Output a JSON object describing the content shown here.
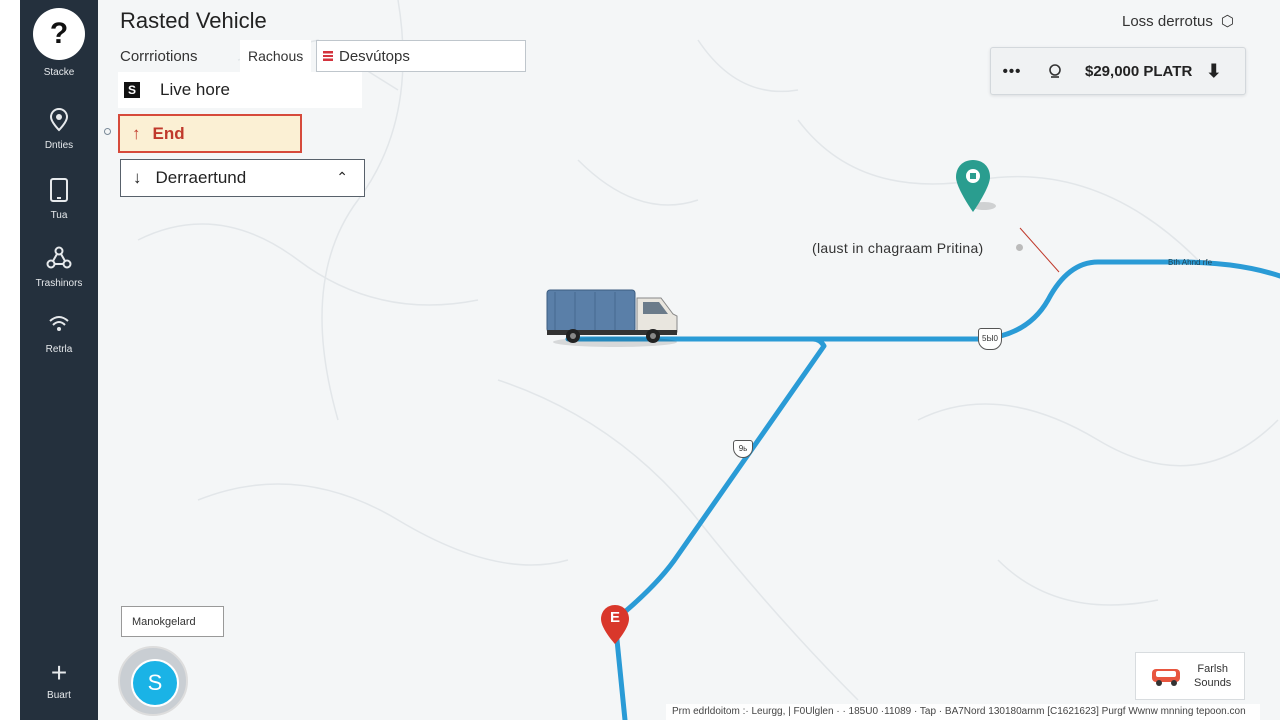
{
  "sidebar": {
    "help": {
      "glyph": "?",
      "label": "Stacke"
    },
    "items": [
      {
        "label": "Dnties",
        "icon": "map-pin-icon"
      },
      {
        "label": "Tua",
        "icon": "tablet-icon"
      },
      {
        "label": "Trashinors",
        "icon": "network-icon"
      },
      {
        "label": "Retrla",
        "icon": "wifi-icon"
      }
    ],
    "bottom": {
      "glyph": "+",
      "label": "Buart"
    }
  },
  "header": {
    "title": "Rasted Vehicle",
    "tab_1": "Corrriotions",
    "tab_2": "Rachous",
    "search_value": "Desvútops"
  },
  "panel": {
    "live_icon": "S",
    "live_label": "Live hore",
    "end_label": "End",
    "dropdown_label": "Derraertund"
  },
  "top_right": {
    "label": "Loss derrotus"
  },
  "stats": {
    "price": "$29,000 PLATR"
  },
  "map": {
    "note": "(laust in chagraam Pritina)",
    "route_badge_1": "5Ы0",
    "route_badge_2": "9ь",
    "road_label": "Bth Ahnd rfe",
    "end_marker": "E",
    "route_color": "#2a9bd6"
  },
  "manage_button": "Manokgelard",
  "s_button": "S",
  "legend": {
    "line_1": "Farlsh",
    "line_2": "Sounds"
  },
  "footer": "Prm edrldoitom :· Leurgg, | F0Ulglen · · 185U0 ·11089 · Tap · BA7Nord  130180arnm [C1621623]  Purgf Wwnw mnning tepoon.con"
}
